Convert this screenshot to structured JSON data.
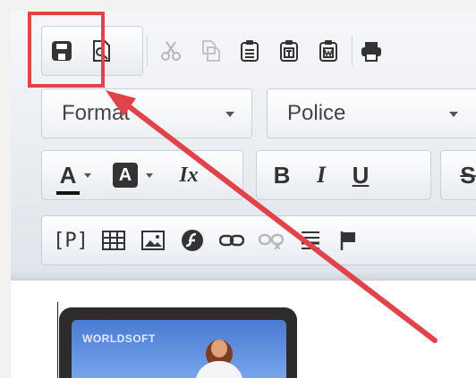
{
  "toolbar": {
    "row1": {
      "buttons": [
        {
          "name": "save-icon",
          "label": "Save"
        },
        {
          "name": "preview-icon",
          "label": "Preview"
        },
        {
          "name": "cut-icon",
          "label": "Cut"
        },
        {
          "name": "copy-icon",
          "label": "Copy"
        },
        {
          "name": "paste-icon",
          "label": "Paste"
        },
        {
          "name": "paste-text-icon",
          "label": "Paste as text"
        },
        {
          "name": "paste-word-icon",
          "label": "Paste from Word"
        },
        {
          "name": "print-icon",
          "label": "Print"
        }
      ]
    },
    "row2": {
      "format_dropdown": {
        "value": "Format"
      },
      "font_dropdown": {
        "value": "Police"
      }
    },
    "row3": {
      "text_color_label": "A",
      "background_color_label": "A",
      "remove_format_label": "Ix",
      "bold_label": "B",
      "italic_label": "I",
      "underline_label": "U",
      "strike_label": "S"
    },
    "row4": {
      "paragraph_label": "[P]"
    }
  },
  "content": {
    "image_brand_text": "WORLDSOFT"
  },
  "colors": {
    "highlight_red": "#e0434a",
    "toolbar_top": "#f6f7f9",
    "toolbar_bottom": "#dfe4ea"
  }
}
